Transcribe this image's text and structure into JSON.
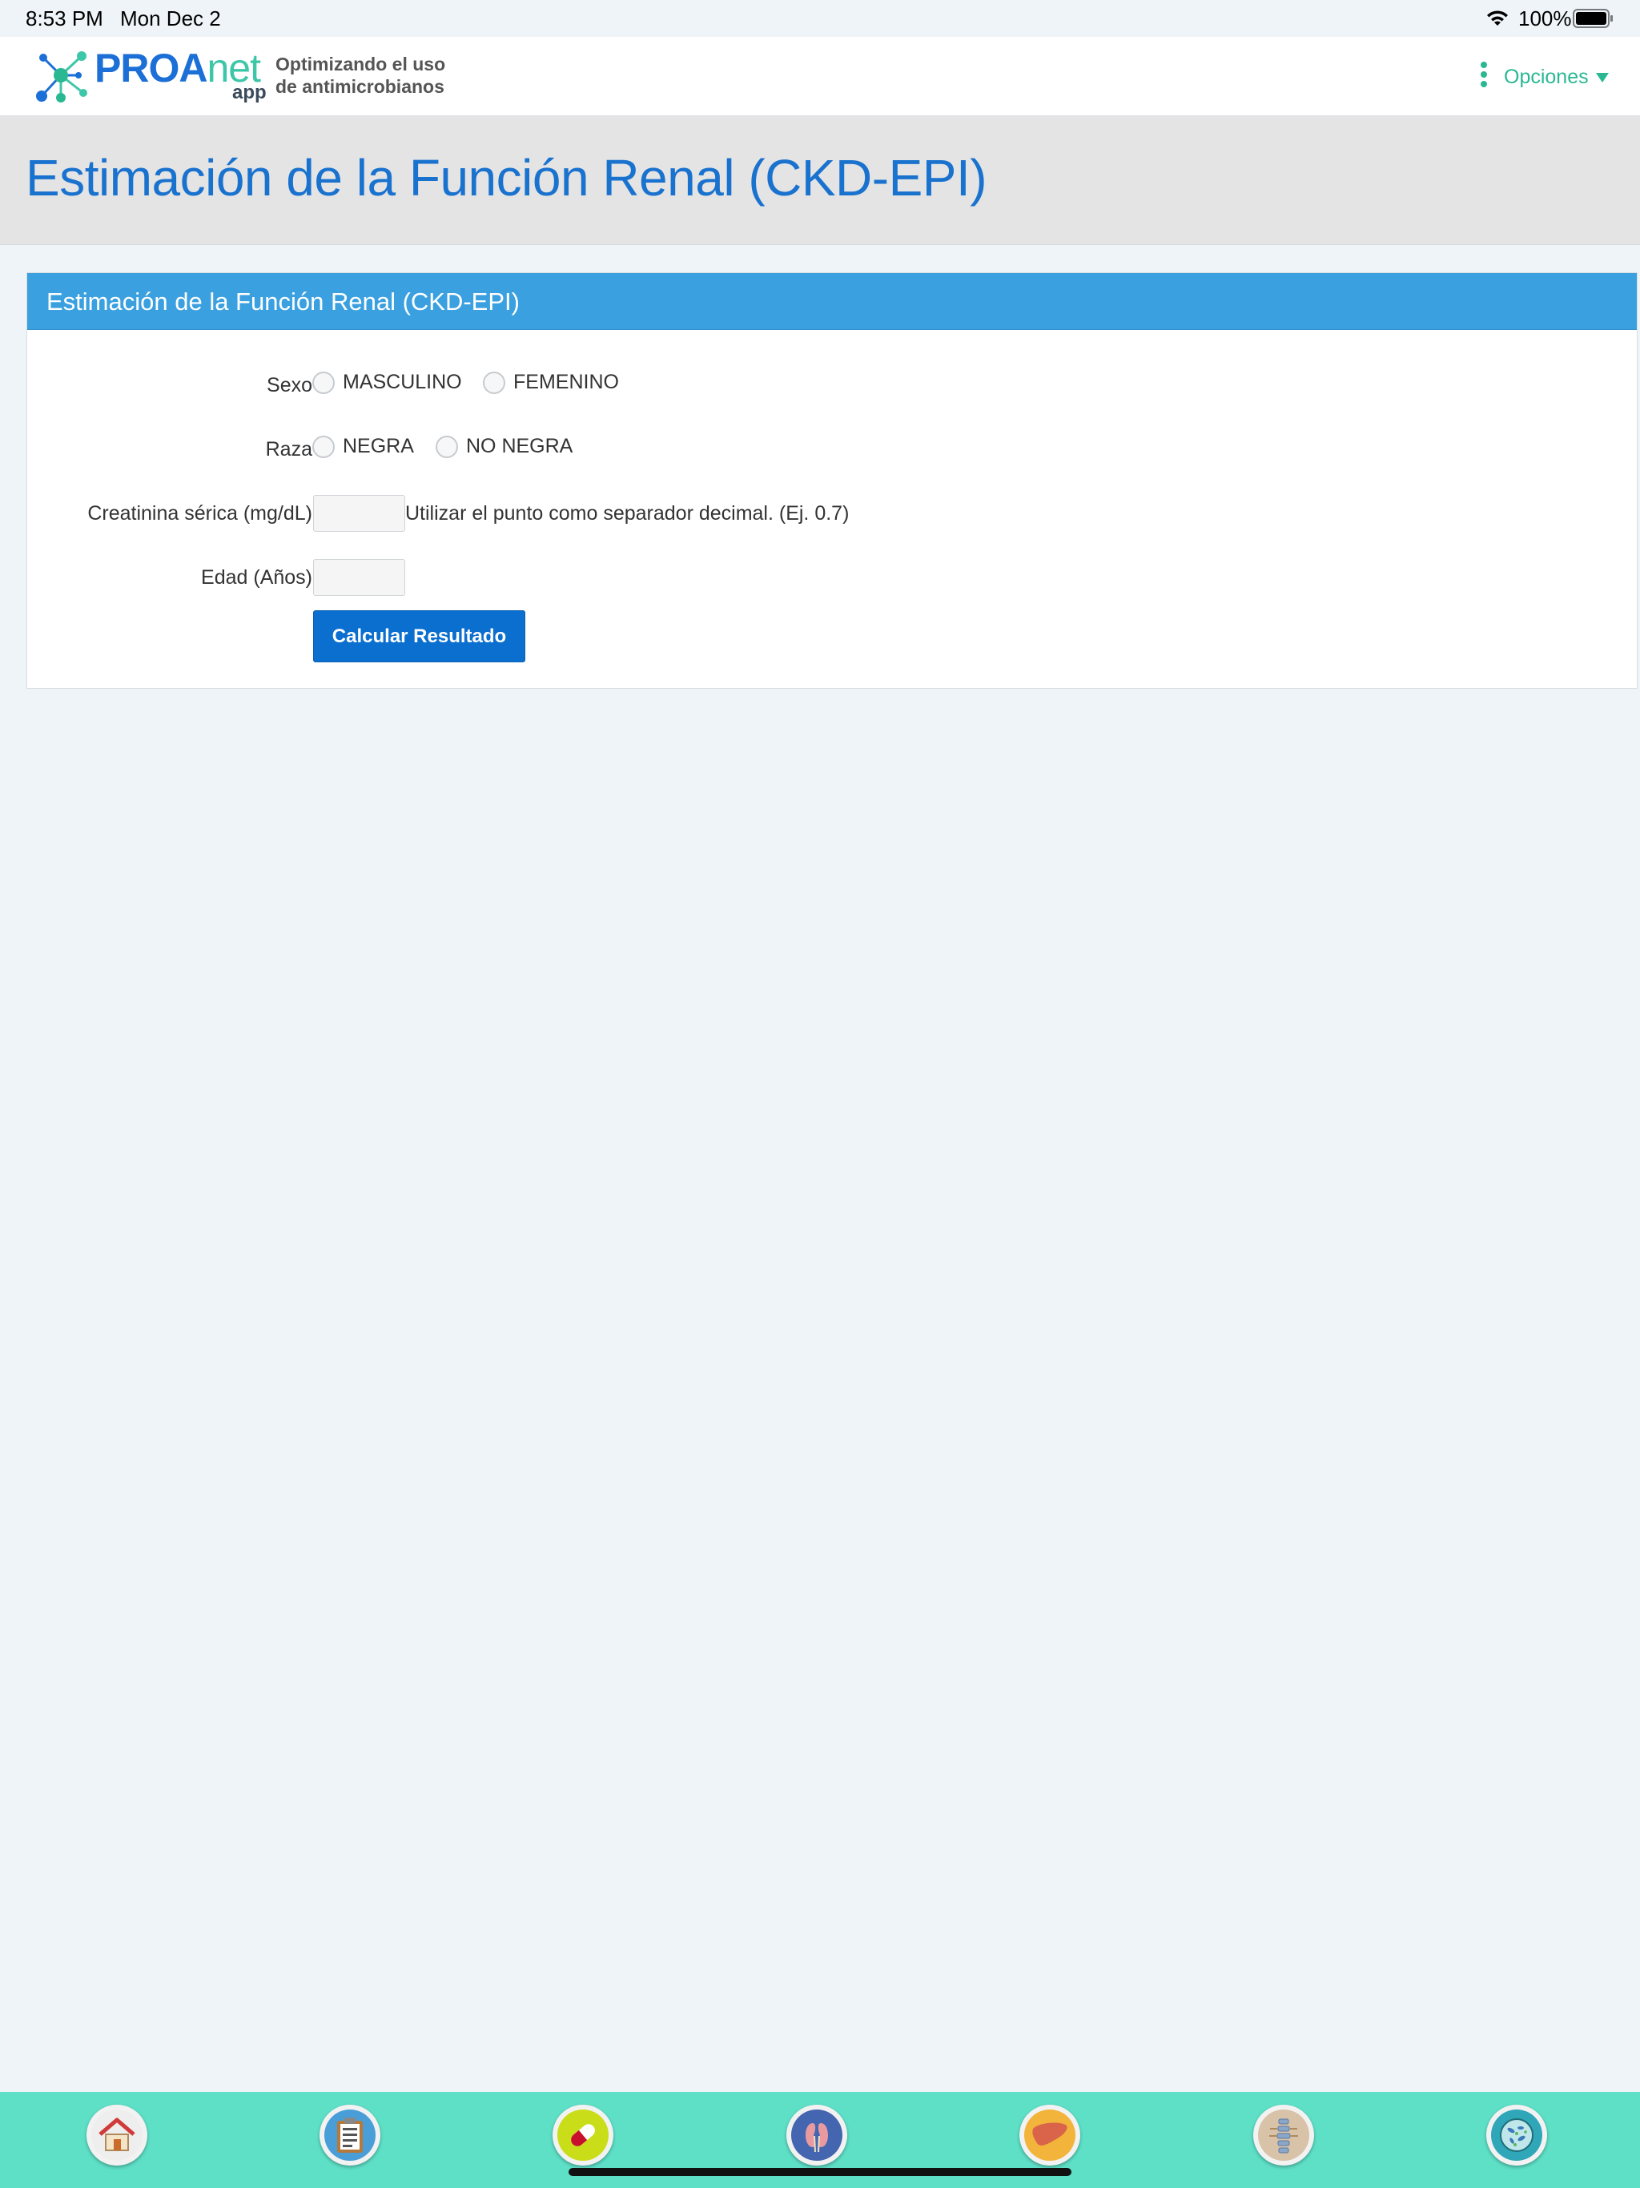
{
  "status_bar": {
    "time": "8:53 PM",
    "date": "Mon Dec 2",
    "battery_pct": "100%"
  },
  "navbar": {
    "brand_proa": "PROA",
    "brand_net": "net",
    "brand_sub": "app",
    "tagline_line1": "Optimizando el uso",
    "tagline_line2": "de antimicrobianos",
    "options_label": "Opciones",
    "accent_color": "#2ab893"
  },
  "page": {
    "title": "Estimación de la Función Renal (CKD-EPI)"
  },
  "panel": {
    "heading": "Estimación de la Función Renal (CKD-EPI)",
    "heading_color": "#3aa0e0",
    "sexo": {
      "label": "Sexo",
      "options": [
        "MASCULINO",
        "FEMENINO"
      ],
      "selected": null
    },
    "raza": {
      "label": "Raza",
      "options": [
        "NEGRA",
        "NO NEGRA"
      ],
      "selected": null
    },
    "creatinina": {
      "label": "Creatinina sérica (mg/dL)",
      "value": "",
      "hint": "Utilizar el punto como separador decimal. (Ej. 0.7)"
    },
    "edad": {
      "label": "Edad (Años)",
      "value": ""
    },
    "submit_label": "Calcular Resultado"
  },
  "tabbar": {
    "background": "#5ee0c7",
    "tabs": [
      {
        "icon": "home-icon"
      },
      {
        "icon": "clipboard-icon"
      },
      {
        "icon": "pill-icon"
      },
      {
        "icon": "kidney-icon"
      },
      {
        "icon": "liver-icon"
      },
      {
        "icon": "spine-icon"
      },
      {
        "icon": "bacteria-icon"
      }
    ]
  }
}
